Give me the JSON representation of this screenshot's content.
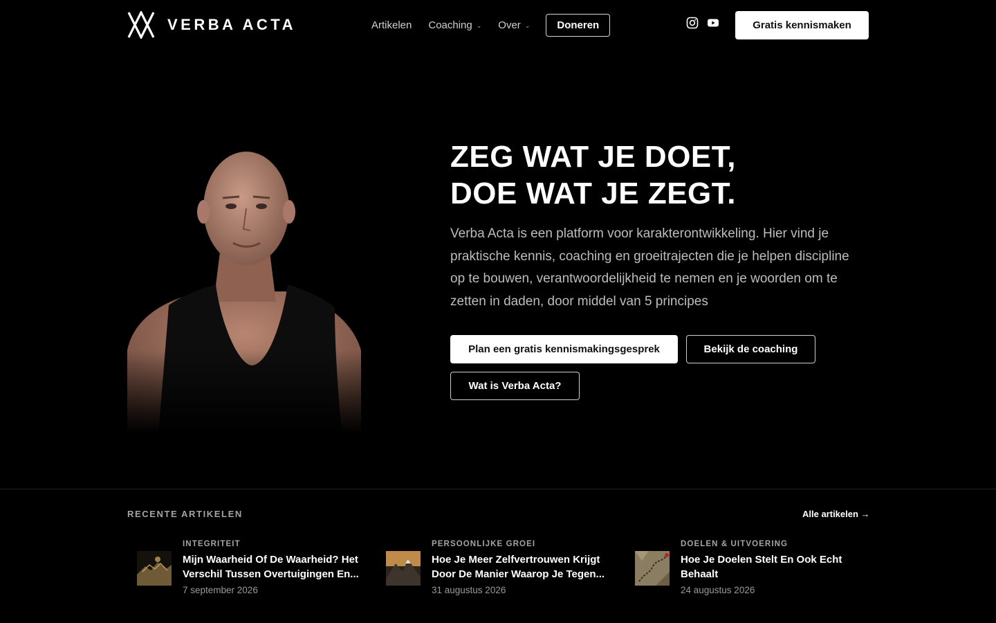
{
  "brand": {
    "name": "VERBA ACTA",
    "logo_icon": "va-monogram-icon"
  },
  "nav": {
    "items": [
      {
        "label": "Artikelen",
        "has_dropdown": false
      },
      {
        "label": "Coaching",
        "has_dropdown": true
      },
      {
        "label": "Over",
        "has_dropdown": true
      }
    ],
    "donate_label": "Doneren"
  },
  "social": {
    "icons": [
      "instagram-icon",
      "youtube-icon"
    ]
  },
  "header_cta": "Gratis kennismaken",
  "hero": {
    "title_line1": "ZEG WAT JE DOET,",
    "title_line2": "DOE WAT JE ZEGT.",
    "description": "Verba Acta is een platform voor karakterontwikkeling. Hier vind je praktische kennis, coaching en groeitrajecten die je helpen discipline op te bouwen, verantwoordelijkheid te nemen en je woorden om te zetten in daden, door middel van 5 principes",
    "buttons": {
      "primary": "Plan een gratis kennismakingsgesprek",
      "secondary": "Bekijk de coaching",
      "tertiary": "Wat is Verba Acta?"
    }
  },
  "recent": {
    "heading": "RECENTE ARTIKELEN",
    "all_link": "Alle artikelen →",
    "articles": [
      {
        "category": "INTEGRITEIT",
        "title": "Mijn Waarheid Of De Waarheid? Het Verschil Tussen Overtuigingen En...",
        "date": "7 september 2026"
      },
      {
        "category": "PERSOONLIJKE GROEI",
        "title": "Hoe Je Meer Zelfvertrouwen Krijgt Door De Manier Waarop Je Tegen...",
        "date": "31 augustus 2026"
      },
      {
        "category": "DOELEN & UITVOERING",
        "title": "Hoe Je Doelen Stelt En Ook Echt Behaalt",
        "date": "24 augustus 2026"
      }
    ]
  },
  "colors": {
    "background": "#000000",
    "text": "#ffffff",
    "muted": "#bdbdbd"
  }
}
